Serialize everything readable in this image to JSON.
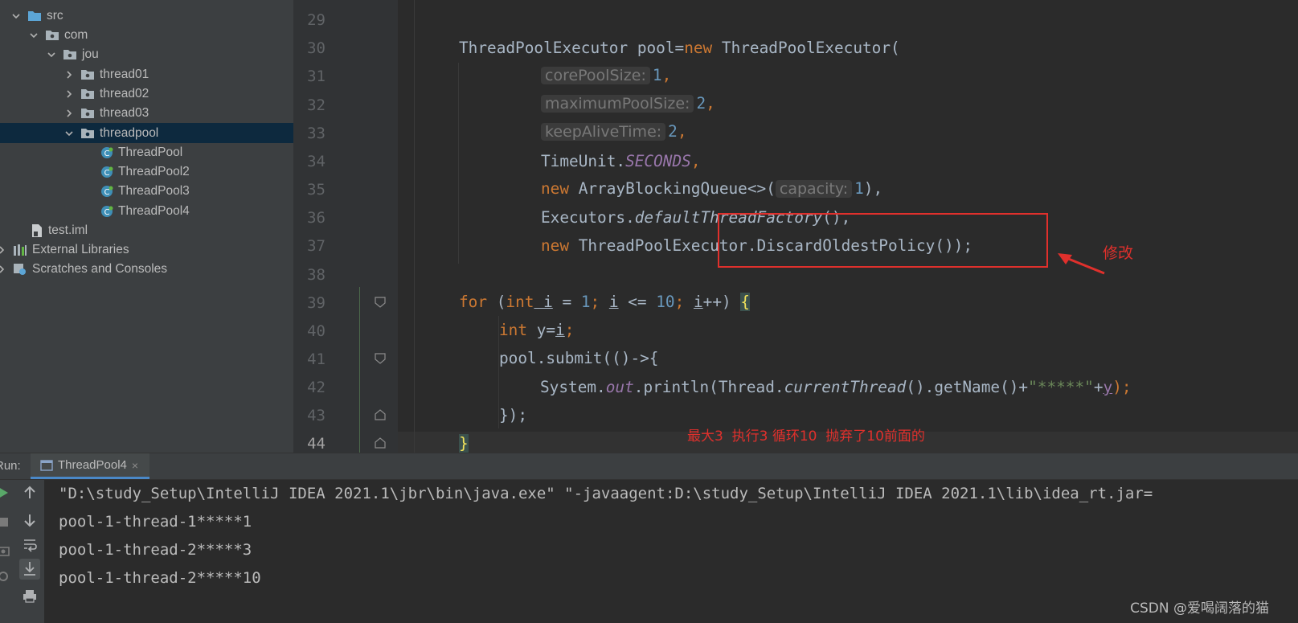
{
  "tree": {
    "items": [
      {
        "label": "src"
      },
      {
        "label": "com"
      },
      {
        "label": "jou"
      },
      {
        "label": "thread01"
      },
      {
        "label": "thread02"
      },
      {
        "label": "thread03"
      },
      {
        "label": "threadpool"
      },
      {
        "label": "ThreadPool"
      },
      {
        "label": "ThreadPool2"
      },
      {
        "label": "ThreadPool3"
      },
      {
        "label": "ThreadPool4"
      },
      {
        "label": "test.iml"
      },
      {
        "label": "External Libraries"
      },
      {
        "label": "Scratches and Consoles"
      }
    ]
  },
  "editor": {
    "line_numbers": [
      "29",
      "30",
      "31",
      "32",
      "33",
      "34",
      "35",
      "36",
      "37",
      "38",
      "39",
      "40",
      "41",
      "42",
      "43",
      "44"
    ],
    "code": {
      "l30": {
        "type1": "ThreadPoolExecutor",
        "var": " pool=",
        "kw": "new",
        "type2": " ThreadPoolExecutor("
      },
      "l31": {
        "hint": "corePoolSize:",
        "val": "1",
        "punct": ","
      },
      "l32": {
        "hint": "maximumPoolSize:",
        "val": "2",
        "punct": ","
      },
      "l33": {
        "hint": "keepAliveTime:",
        "val": "2",
        "punct": ","
      },
      "l34": {
        "cls": "TimeUnit.",
        "field": "SECONDS",
        "punct": ","
      },
      "l35": {
        "kw": "new",
        "cls": " ArrayBlockingQueue<>(",
        "hint": "capacity:",
        "val": "1",
        "punct": "),"
      },
      "l36": {
        "cls": "Executors.",
        "method": "defaultThreadFactory",
        "rest": "(),"
      },
      "l37": {
        "kw": "new",
        "rest": " ThreadPoolExecutor.DiscardOldestPolicy());"
      },
      "l39": {
        "kw1": "for",
        "p1": " (",
        "kw2": "int",
        "v1": " i",
        " eq": " = ",
        "n1": "1",
        "semi1": "; ",
        "v2": "i",
        "le": " <= ",
        "n2": "10",
        "semi2": "; ",
        "v3": "i",
        "inc": "++) ",
        "brace": "{"
      },
      "l40": {
        "kw": "int",
        "p1": " y=",
        "v": "i",
        "semi": ";"
      },
      "l41": {
        "text": "pool.submit(()->{"
      },
      "l42": {
        "p1": "System.",
        "field": "out",
        "p2": ".println(Thread.",
        "method": "currentThread",
        "p3": "().getName()+",
        "str": "\"*****\"",
        "p4": "+",
        "v": "y",
        "semi": ");"
      },
      "l43": {
        "text": "});"
      },
      "l44": {
        "brace": "}"
      }
    },
    "annotation_modify": "修改",
    "annotation_note": "最大3  执行3 循环10  抛弃了10前面的"
  },
  "run": {
    "label": "Run:",
    "tab": "ThreadPool4",
    "tab_close": "×",
    "console_lines": [
      "\"D:\\study_Setup\\IntelliJ IDEA 2021.1\\jbr\\bin\\java.exe\" \"-javaagent:D:\\study_Setup\\IntelliJ IDEA 2021.1\\lib\\idea_rt.jar=",
      "pool-1-thread-1*****1",
      "pool-1-thread-2*****3",
      "pool-1-thread-2*****10"
    ]
  },
  "watermark": "CSDN @爱喝阔落的猫",
  "colors": {
    "annotation_red": "#e0302c",
    "keyword": "#cc7832",
    "number": "#6897bb",
    "field": "#9876aa",
    "string": "#6a8759"
  }
}
